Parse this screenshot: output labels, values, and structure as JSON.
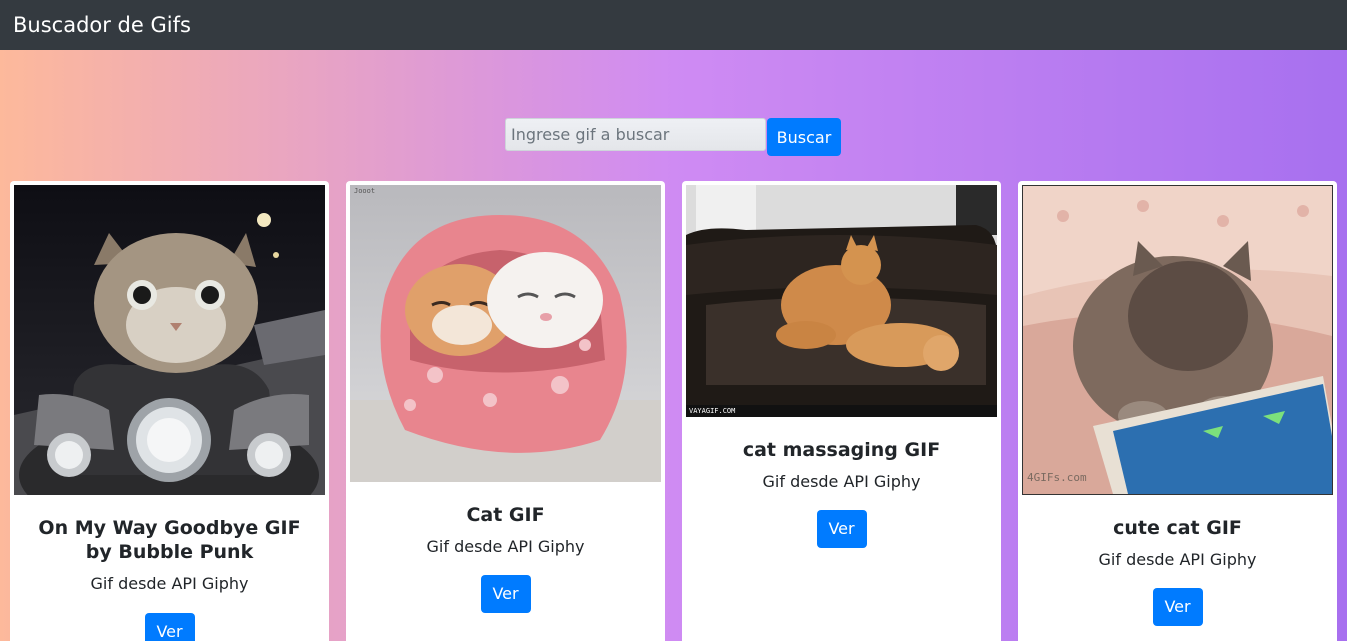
{
  "navbar": {
    "brand": "Buscador de Gifs"
  },
  "search": {
    "placeholder": "Ingrese gif a buscar",
    "value": "",
    "button_label": "Buscar"
  },
  "cards": [
    {
      "title": "On My Way Goodbye GIF by Bubble Punk",
      "subtitle": "Gif desde API Giphy",
      "button_label": "Ver",
      "image_icon": "kitten-on-motorcycle-image"
    },
    {
      "title": "Cat GIF",
      "subtitle": "Gif desde API Giphy",
      "button_label": "Ver",
      "image_icon": "two-cats-in-pink-blanket-image",
      "image_watermark": "Jooot"
    },
    {
      "title": "cat massaging GIF",
      "subtitle": "Gif desde API Giphy",
      "button_label": "Ver",
      "image_icon": "cat-massaging-cat-on-sofa-image",
      "image_watermark": "VAYAGIF.COM"
    },
    {
      "title": "cute cat GIF",
      "subtitle": "Gif desde API Giphy",
      "button_label": "Ver",
      "image_icon": "kitten-playing-with-phone-image",
      "image_watermark": "4GIFs.com"
    }
  ],
  "colors": {
    "navbar_bg": "#343a40",
    "primary": "#007bff",
    "gradient": [
      "#fdb99b",
      "#cf8bf3",
      "#a770ef"
    ]
  }
}
